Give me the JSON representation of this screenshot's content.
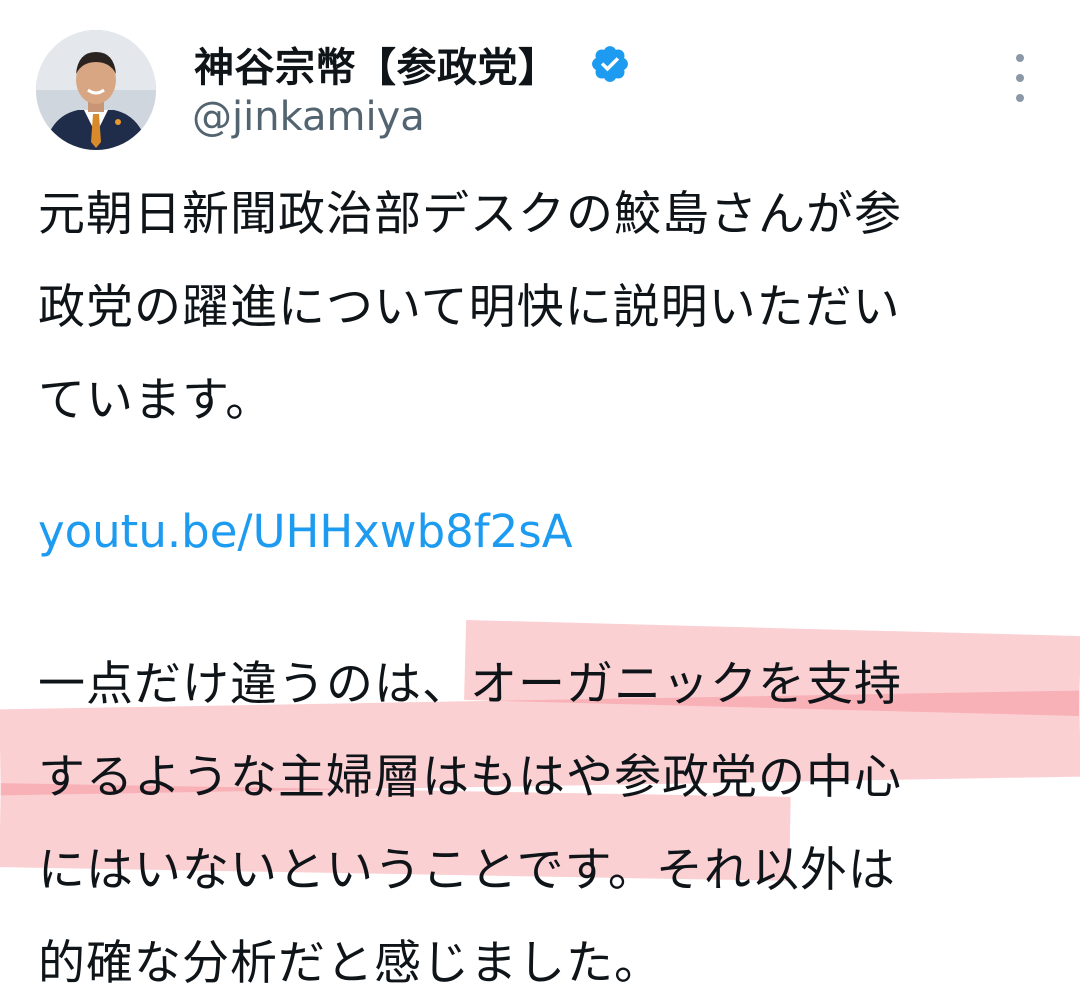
{
  "tweet": {
    "author": {
      "display_name": "神谷宗幣【参政党】",
      "handle": "@jinkamiya",
      "verified": true,
      "avatar_icon": "avatar-photo"
    },
    "menu_icon": "more-vertical-icon",
    "paragraph1": [
      "元朝日新聞政治部デスクの鮫島さんが参",
      "政党の躍進について明快に説明いただい",
      "ています。"
    ],
    "link": "youtu.be/UHHxwb8f2sA",
    "paragraph2": [
      "一点だけ違うのは、オーガニックを支持",
      "するような主婦層はもはや参政党の中心",
      "にはいないということです。それ以外は",
      "的確な分析だと感じました。"
    ],
    "colors": {
      "link": "#1d9bf0",
      "verified_badge": "#1d9bf0",
      "handle": "#536471",
      "highlight": "#f47882"
    }
  }
}
